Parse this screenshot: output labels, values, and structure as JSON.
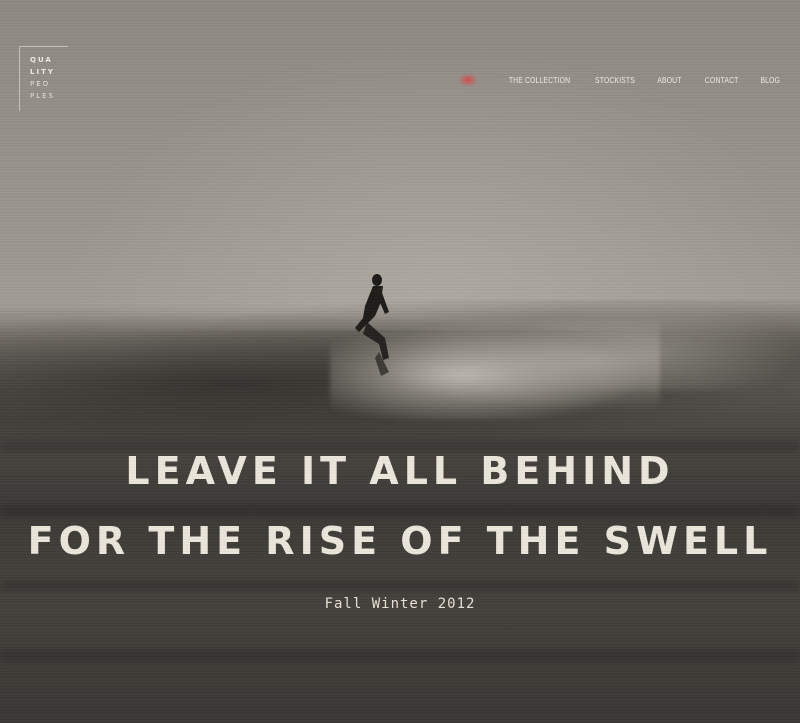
{
  "brand": {
    "logo_lines": [
      "QUA",
      "LITY",
      "PEO",
      "PLES"
    ]
  },
  "nav": {
    "home_icon": "home-icon",
    "items": [
      {
        "label": "THE COLLECTION"
      },
      {
        "label": "STOCKISTS"
      },
      {
        "label": "ABOUT"
      },
      {
        "label": "CONTACT"
      },
      {
        "label": "BLOG"
      }
    ],
    "accent_color": "#dc4646"
  },
  "hero": {
    "headline_line1": "LEAVE IT ALL BEHIND",
    "headline_line2": "FOR THE RISE OF THE SWELL",
    "subtitle": "Fall Winter 2012"
  }
}
